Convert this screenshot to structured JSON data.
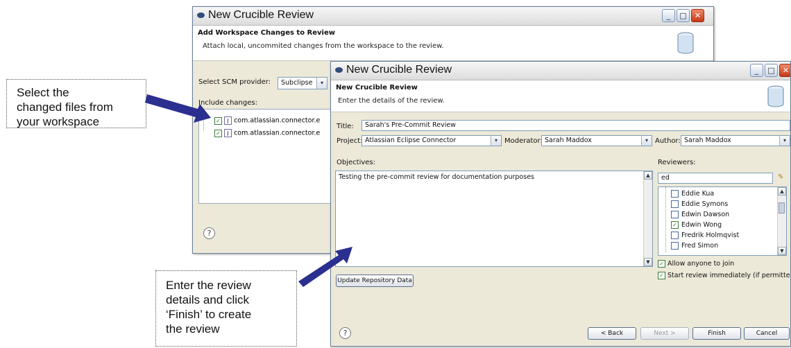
{
  "callouts": {
    "select_files": "Select the\nchanged files from\nyour workspace",
    "enter_details": "Enter the review\ndetails and click\n‘Finish’ to create\nthe review"
  },
  "back_window": {
    "title": "New Crucible Review",
    "header_title": "Add Workspace Changes to Review",
    "header_desc": "Attach local, uncommited changes from the workspace to the review.",
    "scm_label": "Select SCM provider:",
    "scm_value": "Subclipse",
    "include_label": "Include changes:",
    "changes": [
      {
        "label": "com.atlassian.connector.e",
        "checked": true
      },
      {
        "label": "com.atlassian.connector.e",
        "checked": true
      }
    ],
    "help": "?"
  },
  "front_window": {
    "title": "New Crucible Review",
    "header_title": "New Crucible Review",
    "header_desc": "Enter the details of the review.",
    "title_label": "Title:",
    "title_value": "Sarah's Pre-Commit Review",
    "project_label": "Project:",
    "project_value": "Atlassian Eclipse Connector",
    "moderator_label": "Moderator:",
    "moderator_value": "Sarah Maddox",
    "author_label": "Author:",
    "author_value": "Sarah Maddox",
    "objectives_label": "Objectives:",
    "objectives_value": "Testing the pre-commit review for documentation purposes",
    "reviewers_label": "Reviewers:",
    "reviewer_filter": "ed",
    "reviewers": [
      {
        "name": "Eddie Kua",
        "checked": false
      },
      {
        "name": "Eddie Symons",
        "checked": false
      },
      {
        "name": "Edwin Dawson",
        "checked": false
      },
      {
        "name": "Edwin Wong",
        "checked": true
      },
      {
        "name": "Fredrik Holmqvist",
        "checked": false
      },
      {
        "name": "Fred Simon",
        "checked": false
      }
    ],
    "allow_join": "Allow anyone to join",
    "start_immediately": "Start review immediately (if permitted)",
    "update_repo_button": "Update Repository Data",
    "help": "?",
    "back_button": "< Back",
    "next_button": "Next >",
    "finish_button": "Finish",
    "cancel_button": "Cancel"
  },
  "colors": {
    "arrow": "#2b2f8f",
    "close_button": "#d9532b"
  }
}
